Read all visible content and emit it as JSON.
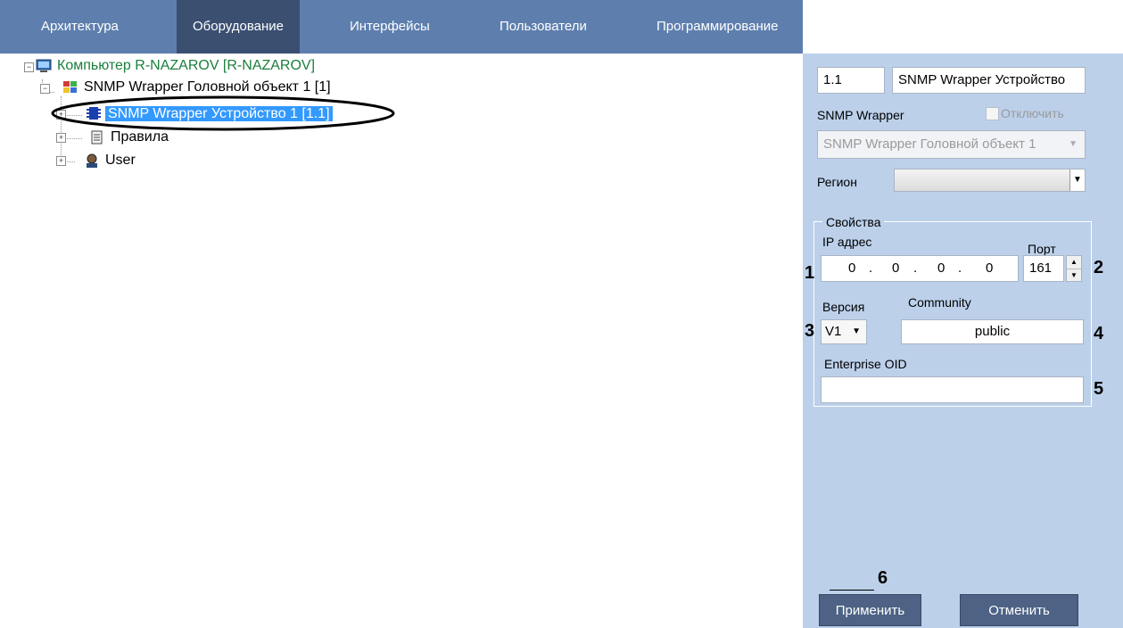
{
  "tabs": [
    {
      "label": "Архитектура",
      "active": false
    },
    {
      "label": "Оборудование",
      "active": true
    },
    {
      "label": "Интерфейсы",
      "active": false
    },
    {
      "label": "Пользователи",
      "active": false
    },
    {
      "label": "Программирование",
      "active": false
    }
  ],
  "tree": {
    "computer": "Компьютер R-NAZAROV [R-NAZAROV]",
    "head_object": "SNMP Wrapper Головной объект 1 [1]",
    "device": "SNMP Wrapper Устройство 1 [1.1]",
    "rules": "Правила",
    "user": "User"
  },
  "panel": {
    "id_value": "1.1",
    "name_value": "SNMP Wrapper Устройство",
    "type_label": "SNMP Wrapper",
    "disable_label": "Отключить",
    "parent_select": "SNMP Wrapper Головной объект 1",
    "region_label": "Регион",
    "region_value": "",
    "props_title": "Свойства",
    "ip_label": "IP адрес",
    "ip_octets": [
      "0",
      "0",
      "0",
      "0"
    ],
    "port_label": "Порт",
    "port_value": "161",
    "version_label": "Версия",
    "version_value": "V1",
    "community_label": "Community",
    "community_value": "public",
    "oid_label": "Enterprise OID",
    "oid_value": "",
    "apply_label": "Применить",
    "cancel_label": "Отменить"
  },
  "callouts": [
    "1",
    "2",
    "3",
    "4",
    "5",
    "6"
  ],
  "colors": {
    "tabbar": "#5e7fae",
    "tab_active": "#3b4f71",
    "panel": "#bcd0ea",
    "button": "#4d6285",
    "tree_link": "#1a7f3c",
    "selection": "#3399ff"
  }
}
